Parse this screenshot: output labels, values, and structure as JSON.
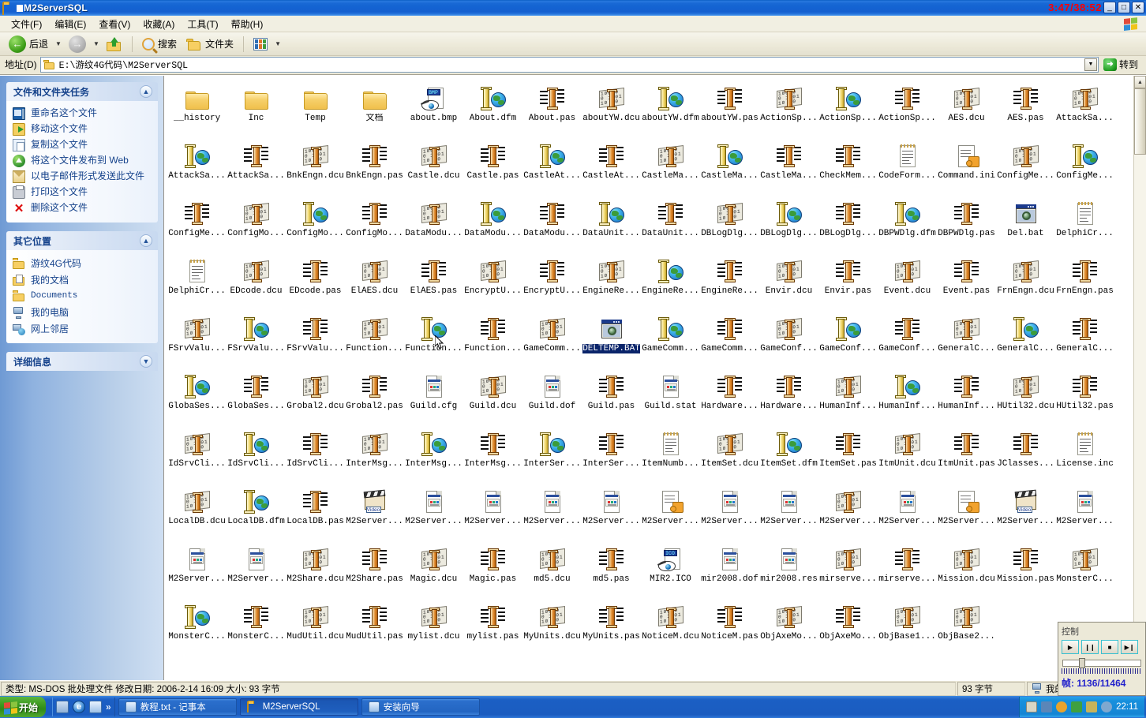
{
  "window": {
    "title": "M2ServerSQL",
    "icon": "folder-icon",
    "overlay_timer": "3:47/38:52",
    "buttons": {
      "minimize": "_",
      "maximize": "□",
      "close": "✕"
    }
  },
  "menubar": {
    "items": [
      {
        "label": "文件(F)",
        "name": "menu-file"
      },
      {
        "label": "编辑(E)",
        "name": "menu-edit"
      },
      {
        "label": "查看(V)",
        "name": "menu-view"
      },
      {
        "label": "收藏(A)",
        "name": "menu-favorites"
      },
      {
        "label": "工具(T)",
        "name": "menu-tools"
      },
      {
        "label": "帮助(H)",
        "name": "menu-help"
      }
    ]
  },
  "toolbar": {
    "back": "后退",
    "forward": "",
    "up": "",
    "search": "搜索",
    "folders": "文件夹",
    "views": ""
  },
  "address": {
    "label": "地址(D)",
    "value": "E:\\游纹4G代码\\M2ServerSQL",
    "go_label": "转到"
  },
  "sidebar": {
    "panels": [
      {
        "title": "文件和文件夹任务",
        "collapse_icon": "chevron-up-icon",
        "items": [
          {
            "label": "重命名这个文件",
            "icon": "rename-icon"
          },
          {
            "label": "移动这个文件",
            "icon": "move-icon"
          },
          {
            "label": "复制这个文件",
            "icon": "copy-icon"
          },
          {
            "label": "将这个文件发布到 Web",
            "icon": "publish-web-icon"
          },
          {
            "label": "以电子邮件形式发送此文件",
            "icon": "email-icon"
          },
          {
            "label": "打印这个文件",
            "icon": "print-icon"
          },
          {
            "label": "删除这个文件",
            "icon": "delete-icon"
          }
        ]
      },
      {
        "title": "其它位置",
        "collapse_icon": "chevron-up-icon",
        "items": [
          {
            "label": "游纹4G代码",
            "icon": "folder-icon"
          },
          {
            "label": "我的文档",
            "icon": "my-documents-icon"
          },
          {
            "label": "Documents",
            "icon": "folder-icon"
          },
          {
            "label": "我的电脑",
            "icon": "my-computer-icon"
          },
          {
            "label": "网上邻居",
            "icon": "network-icon"
          }
        ]
      },
      {
        "title": "详细信息",
        "collapse_icon": "chevron-down-icon",
        "items": []
      }
    ]
  },
  "files": [
    {
      "name": "__history",
      "type": "folder"
    },
    {
      "name": "Inc",
      "type": "folder"
    },
    {
      "name": "Temp",
      "type": "folder"
    },
    {
      "name": "文档",
      "type": "folder"
    },
    {
      "name": "about.bmp",
      "type": "img",
      "tag": "BMP"
    },
    {
      "name": "About.dfm",
      "type": "dfm"
    },
    {
      "name": "About.pas",
      "type": "pas"
    },
    {
      "name": "aboutYW.dcu",
      "type": "dcu"
    },
    {
      "name": "aboutYW.dfm",
      "type": "dfm"
    },
    {
      "name": "aboutYW.pas",
      "type": "pas"
    },
    {
      "name": "ActionSp...",
      "type": "dcu"
    },
    {
      "name": "ActionSp...",
      "type": "dfm"
    },
    {
      "name": "ActionSp...",
      "type": "pas"
    },
    {
      "name": "AES.dcu",
      "type": "dcu"
    },
    {
      "name": "AES.pas",
      "type": "pas"
    },
    {
      "name": "AttackSa...",
      "type": "dcu"
    },
    {
      "name": "AttackSa...",
      "type": "dfm"
    },
    {
      "name": "AttackSa...",
      "type": "pas"
    },
    {
      "name": "BnkEngn.dcu",
      "type": "dcu"
    },
    {
      "name": "BnkEngn.pas",
      "type": "pas"
    },
    {
      "name": "Castle.dcu",
      "type": "dcu"
    },
    {
      "name": "Castle.pas",
      "type": "pas"
    },
    {
      "name": "CastleAt...",
      "type": "dfm"
    },
    {
      "name": "CastleAt...",
      "type": "pas"
    },
    {
      "name": "CastleMa...",
      "type": "dcu"
    },
    {
      "name": "CastleMa...",
      "type": "dfm"
    },
    {
      "name": "CastleMa...",
      "type": "pas"
    },
    {
      "name": "CheckMem...",
      "type": "pas"
    },
    {
      "name": "CodeForm...",
      "type": "txt"
    },
    {
      "name": "Command.ini",
      "type": "app"
    },
    {
      "name": "ConfigMe...",
      "type": "dcu"
    },
    {
      "name": "ConfigMe...",
      "type": "dfm"
    },
    {
      "name": "ConfigMe...",
      "type": "pas"
    },
    {
      "name": "ConfigMo...",
      "type": "dcu"
    },
    {
      "name": "ConfigMo...",
      "type": "dfm"
    },
    {
      "name": "ConfigMo...",
      "type": "pas"
    },
    {
      "name": "DataModu...",
      "type": "dcu"
    },
    {
      "name": "DataModu...",
      "type": "dfm"
    },
    {
      "name": "DataModu...",
      "type": "pas"
    },
    {
      "name": "DataUnit...",
      "type": "dfm"
    },
    {
      "name": "DataUnit...",
      "type": "pas"
    },
    {
      "name": "DBLogDlg...",
      "type": "dcu"
    },
    {
      "name": "DBLogDlg...",
      "type": "dfm"
    },
    {
      "name": "DBLogDlg...",
      "type": "pas"
    },
    {
      "name": "DBPWDlg.dfm",
      "type": "dfm"
    },
    {
      "name": "DBPWDlg.pas",
      "type": "pas"
    },
    {
      "name": "Del.bat",
      "type": "bat"
    },
    {
      "name": "DelphiCr...",
      "type": "txt"
    },
    {
      "name": "DelphiCr...",
      "type": "txt"
    },
    {
      "name": "EDcode.dcu",
      "type": "dcu"
    },
    {
      "name": "EDcode.pas",
      "type": "pas"
    },
    {
      "name": "ElAES.dcu",
      "type": "dcu"
    },
    {
      "name": "ElAES.pas",
      "type": "pas"
    },
    {
      "name": "EncryptU...",
      "type": "dcu"
    },
    {
      "name": "EncryptU...",
      "type": "pas"
    },
    {
      "name": "EngineRe...",
      "type": "dcu"
    },
    {
      "name": "EngineRe...",
      "type": "dfm"
    },
    {
      "name": "EngineRe...",
      "type": "pas"
    },
    {
      "name": "Envir.dcu",
      "type": "dcu"
    },
    {
      "name": "Envir.pas",
      "type": "pas"
    },
    {
      "name": "Event.dcu",
      "type": "dcu"
    },
    {
      "name": "Event.pas",
      "type": "pas"
    },
    {
      "name": "FrnEngn.dcu",
      "type": "dcu"
    },
    {
      "name": "FrnEngn.pas",
      "type": "pas"
    },
    {
      "name": "FSrvValu...",
      "type": "dcu"
    },
    {
      "name": "FSrvValu...",
      "type": "dfm"
    },
    {
      "name": "FSrvValu...",
      "type": "pas"
    },
    {
      "name": "Function...",
      "type": "dcu"
    },
    {
      "name": "Function...",
      "type": "dfm"
    },
    {
      "name": "Function...",
      "type": "pas"
    },
    {
      "name": "GameComm...",
      "type": "dcu"
    },
    {
      "name": "DELTEMP.BAT",
      "type": "bat",
      "selected": true
    },
    {
      "name": "GameComm...",
      "type": "dfm"
    },
    {
      "name": "GameComm...",
      "type": "pas"
    },
    {
      "name": "GameConf...",
      "type": "dcu"
    },
    {
      "name": "GameConf...",
      "type": "dfm"
    },
    {
      "name": "GameConf...",
      "type": "pas"
    },
    {
      "name": "GeneralC...",
      "type": "dcu"
    },
    {
      "name": "GeneralC...",
      "type": "dfm"
    },
    {
      "name": "GeneralC...",
      "type": "pas"
    },
    {
      "name": "GlobaSes...",
      "type": "dfm"
    },
    {
      "name": "GlobaSes...",
      "type": "pas"
    },
    {
      "name": "Grobal2.dcu",
      "type": "dcu"
    },
    {
      "name": "Grobal2.pas",
      "type": "pas"
    },
    {
      "name": "Guild.cfg",
      "type": "doc"
    },
    {
      "name": "Guild.dcu",
      "type": "dcu"
    },
    {
      "name": "Guild.dof",
      "type": "doc"
    },
    {
      "name": "Guild.pas",
      "type": "pas"
    },
    {
      "name": "Guild.stat",
      "type": "doc"
    },
    {
      "name": "Hardware...",
      "type": "pas"
    },
    {
      "name": "Hardware...",
      "type": "pas"
    },
    {
      "name": "HumanInf...",
      "type": "dcu"
    },
    {
      "name": "HumanInf...",
      "type": "dfm"
    },
    {
      "name": "HumanInf...",
      "type": "pas"
    },
    {
      "name": "HUtil32.dcu",
      "type": "dcu"
    },
    {
      "name": "HUtil32.pas",
      "type": "pas"
    },
    {
      "name": "IdSrvCli...",
      "type": "dcu"
    },
    {
      "name": "IdSrvCli...",
      "type": "dfm"
    },
    {
      "name": "IdSrvCli...",
      "type": "pas"
    },
    {
      "name": "InterMsg...",
      "type": "dcu"
    },
    {
      "name": "InterMsg...",
      "type": "dfm"
    },
    {
      "name": "InterMsg...",
      "type": "pas"
    },
    {
      "name": "InterSer...",
      "type": "dfm"
    },
    {
      "name": "InterSer...",
      "type": "pas"
    },
    {
      "name": "ItemNumb...",
      "type": "txt"
    },
    {
      "name": "ItemSet.dcu",
      "type": "dcu"
    },
    {
      "name": "ItemSet.dfm",
      "type": "dfm"
    },
    {
      "name": "ItemSet.pas",
      "type": "pas"
    },
    {
      "name": "ItmUnit.dcu",
      "type": "dcu"
    },
    {
      "name": "ItmUnit.pas",
      "type": "pas"
    },
    {
      "name": "JClasses...",
      "type": "pas"
    },
    {
      "name": "License.inc",
      "type": "txt"
    },
    {
      "name": "LocalDB.dcu",
      "type": "dcu"
    },
    {
      "name": "LocalDB.dfm",
      "type": "dfm"
    },
    {
      "name": "LocalDB.pas",
      "type": "pas"
    },
    {
      "name": "M2Server...",
      "type": "video"
    },
    {
      "name": "M2Server...",
      "type": "doc"
    },
    {
      "name": "M2Server...",
      "type": "doc"
    },
    {
      "name": "M2Server...",
      "type": "doc"
    },
    {
      "name": "M2Server...",
      "type": "doc"
    },
    {
      "name": "M2Server...",
      "type": "app"
    },
    {
      "name": "M2Server...",
      "type": "doc"
    },
    {
      "name": "M2Server...",
      "type": "doc"
    },
    {
      "name": "M2Server...",
      "type": "dcu"
    },
    {
      "name": "M2Server...",
      "type": "doc"
    },
    {
      "name": "M2Server...",
      "type": "app"
    },
    {
      "name": "M2Server...",
      "type": "video"
    },
    {
      "name": "M2Server...",
      "type": "doc"
    },
    {
      "name": "M2Server...",
      "type": "doc"
    },
    {
      "name": "M2Server...",
      "type": "doc"
    },
    {
      "name": "M2Share.dcu",
      "type": "dcu"
    },
    {
      "name": "M2Share.pas",
      "type": "pas"
    },
    {
      "name": "Magic.dcu",
      "type": "dcu"
    },
    {
      "name": "Magic.pas",
      "type": "pas"
    },
    {
      "name": "md5.dcu",
      "type": "dcu"
    },
    {
      "name": "md5.pas",
      "type": "pas"
    },
    {
      "name": "MIR2.ICO",
      "type": "img",
      "tag": "ICO"
    },
    {
      "name": "mir2008.dof",
      "type": "doc"
    },
    {
      "name": "mir2008.res",
      "type": "doc"
    },
    {
      "name": "mirserve...",
      "type": "dcu"
    },
    {
      "name": "mirserve...",
      "type": "pas"
    },
    {
      "name": "Mission.dcu",
      "type": "dcu"
    },
    {
      "name": "Mission.pas",
      "type": "pas"
    },
    {
      "name": "MonsterC...",
      "type": "dcu"
    },
    {
      "name": "MonsterC...",
      "type": "dfm"
    },
    {
      "name": "MonsterC...",
      "type": "pas"
    },
    {
      "name": "MudUtil.dcu",
      "type": "dcu"
    },
    {
      "name": "MudUtil.pas",
      "type": "pas"
    },
    {
      "name": "mylist.dcu",
      "type": "dcu"
    },
    {
      "name": "mylist.pas",
      "type": "pas"
    },
    {
      "name": "MyUnits.dcu",
      "type": "dcu"
    },
    {
      "name": "MyUnits.pas",
      "type": "pas"
    },
    {
      "name": "NoticeM.dcu",
      "type": "dcu"
    },
    {
      "name": "NoticeM.pas",
      "type": "pas"
    },
    {
      "name": "ObjAxeMo...",
      "type": "dcu"
    },
    {
      "name": "ObjAxeMo...",
      "type": "pas"
    },
    {
      "name": "ObjBase1...",
      "type": "dcu"
    },
    {
      "name": "ObjBase2...",
      "type": "dcu"
    }
  ],
  "statusbar": {
    "details": "类型: MS-DOS 批处理文件 修改日期: 2006-2-14 16:09 大小: 93 字节",
    "size": "93 字节",
    "location": "我的电脑"
  },
  "taskbar": {
    "start": "开始",
    "quicklaunch_chevron": "»",
    "buttons": [
      {
        "label": "教程.txt - 记事本",
        "active": false,
        "icon": "notepad-icon"
      },
      {
        "label": "M2ServerSQL",
        "active": true,
        "icon": "folder-icon"
      },
      {
        "label": "安装向导",
        "active": false,
        "icon": "setup-wizard-icon"
      }
    ],
    "clock": "22:11"
  },
  "control_panel": {
    "title": "控制",
    "buttons": [
      {
        "label": "▶",
        "name": "play-button"
      },
      {
        "label": "❙❙",
        "name": "pause-button"
      },
      {
        "label": "■",
        "name": "stop-button"
      },
      {
        "label": "▶❙",
        "name": "next-frame-button"
      }
    ],
    "frame_label": "帧:",
    "frame_value": "1136/11464"
  }
}
